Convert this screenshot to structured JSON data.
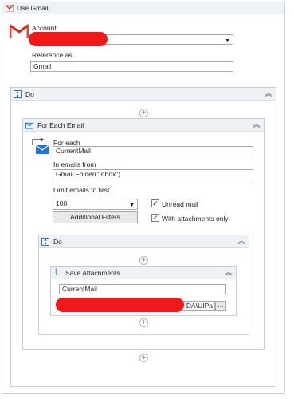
{
  "gmail": {
    "title": "Use Gmail",
    "account_label": "Account",
    "account_value": "",
    "reference_label": "Reference as",
    "reference_value": "Gmail"
  },
  "do_outer": {
    "title": "Do"
  },
  "for_each": {
    "title": "For Each Email",
    "for_each_label": "For each",
    "for_each_value": "CurrentMail",
    "emails_from_label": "In emails from",
    "emails_from_value": "Gmail.Folder(\"Inbox\")",
    "limit_label": "Limit emails to first",
    "limit_value": "100",
    "unread_label": "Unread mail",
    "unread_checked": "✓",
    "attachments_label": "With attachments only",
    "attachments_checked": "✓",
    "filters_button": "Additional Filters"
  },
  "do_inner": {
    "title": "Do"
  },
  "save_attachments": {
    "title": "Save Attachments",
    "mail_value": "CurrentMail",
    "path_value": "DA\\UIPa",
    "browse_label": "..."
  },
  "colors": {
    "gmail_red": "#ea4335",
    "accent_blue": "#1a73e8",
    "redaction": "#f01818"
  }
}
